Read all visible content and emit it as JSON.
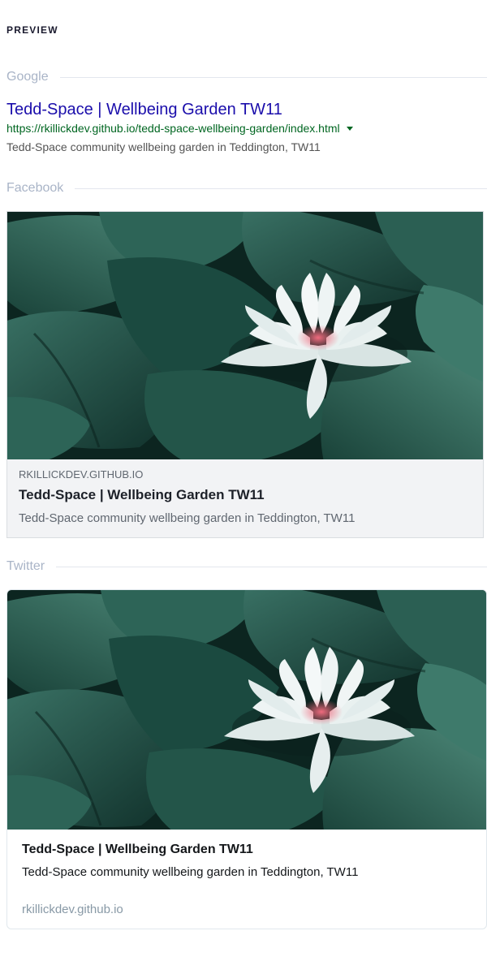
{
  "header": {
    "title": "PREVIEW"
  },
  "sections": {
    "google": "Google",
    "facebook": "Facebook",
    "twitter": "Twitter"
  },
  "google": {
    "title": "Tedd-Space | Wellbeing Garden TW11",
    "url": "https://rkillickdev.github.io/tedd-space-wellbeing-garden/index.html",
    "description": "Tedd-Space community wellbeing garden in Teddington, TW11"
  },
  "facebook": {
    "domain": "RKILLICKDEV.GITHUB.IO",
    "title": "Tedd-Space | Wellbeing Garden TW11",
    "description": "Tedd-Space community wellbeing garden in Teddington, TW11"
  },
  "twitter": {
    "title": "Tedd-Space | Wellbeing Garden TW11",
    "description": "Tedd-Space community wellbeing garden in Teddington, TW11",
    "domain": "rkillickdev.github.io"
  },
  "colors": {
    "google_title": "#1a0dab",
    "google_url": "#006621",
    "leaf_dark": "#0e2a24",
    "leaf_mid": "#24574a",
    "petal": "#e9f1f0",
    "petal_center": "#f07b8a"
  },
  "icons": {
    "url_dropdown": "caret-down-icon",
    "og_image": "water-lily-photo"
  }
}
